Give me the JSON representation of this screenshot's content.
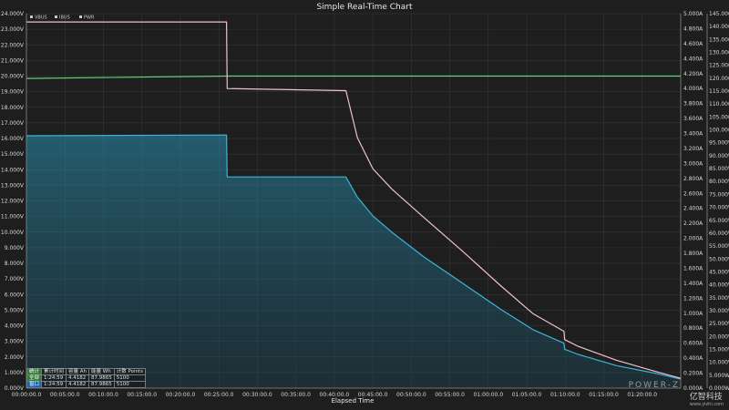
{
  "chart_data": {
    "type": "line",
    "title": "Simple Real-Time Chart",
    "xlabel": "Elapsed Time",
    "xlim": [
      0,
      5100
    ],
    "x_ticks": [
      "00:00:00.0",
      "00:05:00.0",
      "00:10:00.0",
      "00:15:00.0",
      "00:20:00.0",
      "00:25:00.0",
      "00:30:00.0",
      "00:35:00.0",
      "00:40:00.0",
      "00:45:00.0",
      "00:50:00.0",
      "00:55:00.0",
      "01:00:00.0",
      "01:05:00.0",
      "01:10:00.0",
      "01:15:00.0",
      "01:20:00.0"
    ],
    "y_left": {
      "lim": [
        0,
        24
      ],
      "ticks": [
        "0.000V",
        "1.000V",
        "2.000V",
        "3.000V",
        "4.000V",
        "5.000V",
        "6.000V",
        "7.000V",
        "8.000V",
        "9.000V",
        "10.000V",
        "11.000V",
        "12.000V",
        "13.000V",
        "14.000V",
        "15.000V",
        "16.000V",
        "17.000V",
        "18.000V",
        "19.000V",
        "20.000V",
        "21.000V",
        "22.000V",
        "23.000V",
        "24.000V"
      ]
    },
    "y_right_a": {
      "lim": [
        0,
        5
      ],
      "ticks": [
        "0.000A",
        "0.200A",
        "0.400A",
        "0.600A",
        "0.800A",
        "1.000A",
        "1.200A",
        "1.400A",
        "1.600A",
        "1.800A",
        "2.000A",
        "2.200A",
        "2.400A",
        "2.600A",
        "2.800A",
        "3.000A",
        "3.200A",
        "3.400A",
        "3.600A",
        "3.800A",
        "4.000A",
        "4.200A",
        "4.400A",
        "4.600A",
        "4.800A",
        "5.000A"
      ]
    },
    "y_right_b": {
      "lim": [
        0,
        145
      ],
      "ticks": [
        "0.000W",
        "5.000W",
        "10.000W",
        "15.000W",
        "20.000W",
        "25.000W",
        "30.000W",
        "35.000W",
        "40.000W",
        "45.000W",
        "50.000W",
        "55.000W",
        "60.000W",
        "65.000W",
        "70.000W",
        "75.000W",
        "80.000W",
        "85.000W",
        "90.000W",
        "95.000W",
        "100.000W",
        "105.000W",
        "110.000W",
        "115.000W",
        "120.000W",
        "125.000W",
        "130.000W",
        "135.000W",
        "140.000W",
        "145.000W"
      ]
    },
    "legend": [
      "VBUS",
      "IBUS",
      "PWR"
    ],
    "series": [
      {
        "name": "VBUS",
        "axis": "left",
        "color": "#5fd37a",
        "x": [
          0,
          1560,
          5100
        ],
        "y": [
          19.85,
          20.0,
          20.0
        ]
      },
      {
        "name": "IBUS",
        "axis": "right_a",
        "color": "#3ab5d8",
        "fill": true,
        "x": [
          0,
          1560,
          1565,
          2490,
          2580,
          2700,
          2850,
          3100,
          3400,
          3700,
          3950,
          4190,
          4195,
          4300,
          4600,
          4900,
          5100
        ],
        "y": [
          3.37,
          3.38,
          2.82,
          2.82,
          2.55,
          2.3,
          2.08,
          1.75,
          1.4,
          1.05,
          0.78,
          0.6,
          0.52,
          0.45,
          0.3,
          0.2,
          0.12
        ]
      },
      {
        "name": "PWR",
        "axis": "right_b",
        "color": "#f0bfd0",
        "x": [
          0,
          1560,
          1565,
          2490,
          2580,
          2700,
          2850,
          3100,
          3400,
          3700,
          3950,
          4190,
          4195,
          4300,
          4600,
          4900,
          5100
        ],
        "y": [
          141.8,
          141.8,
          116.0,
          115.2,
          97.0,
          85.0,
          77.0,
          66.0,
          53.0,
          39.5,
          28.8,
          22.0,
          18.8,
          16.2,
          10.8,
          6.5,
          3.8
        ]
      }
    ]
  },
  "stats": {
    "header": [
      "统计",
      "累计时间",
      "容量 Ah",
      "能量 Wh",
      "计数 Points"
    ],
    "rows": [
      [
        "全部",
        "1:24:59",
        "4.4182",
        "87.9865",
        "5100"
      ],
      [
        "窗口",
        "1:24:59",
        "4.4182",
        "87.9865",
        "5100"
      ]
    ]
  },
  "brand": "POWER-Z",
  "watermark": {
    "main": "亿智科技",
    "sub": "www.yizhi.com"
  },
  "colors": {
    "background": "#1e1e1e",
    "grid": "#3a3a3a",
    "axis": "#8a8a8a"
  }
}
